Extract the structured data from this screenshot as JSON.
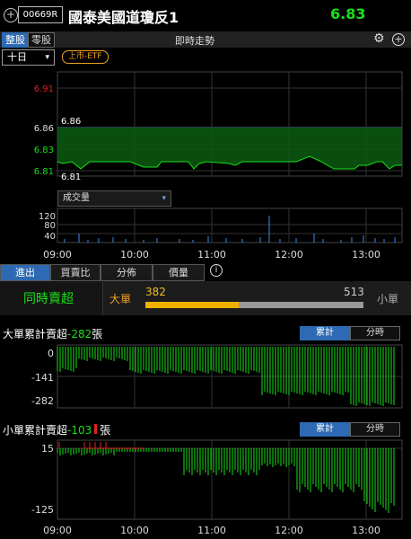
{
  "header": {
    "code": "00669R",
    "title": "國泰美國道瓊反1",
    "price": "6.83"
  },
  "toolbar": {
    "tab_odd": "整股",
    "tab_lot": "零股",
    "section_title": "即時走勢",
    "period": "十日",
    "badge": "上市-ETF"
  },
  "price_chart": {
    "y_labels": [
      "6.91",
      "6.86",
      "6.83",
      "6.81"
    ],
    "hi_label": "6.86",
    "lo_label": "6.81",
    "volume_select": "成交量",
    "vol_labels": [
      "120",
      "80",
      "40"
    ],
    "x_labels": [
      "09:00",
      "10:00",
      "11:00",
      "12:00",
      "13:00"
    ]
  },
  "tabs": [
    "進出",
    "買賣比",
    "分佈",
    "價量"
  ],
  "summary": {
    "simul": "同時賣超",
    "big": "大單",
    "small": "小單",
    "big_value": "382",
    "small_value": "513",
    "big_ratio": 0.427
  },
  "big_acc": {
    "label_prefix": "大單累計賣超",
    "value": "-282",
    "unit": "張",
    "btn_acc": "累計",
    "btn_time": "分時",
    "y_labels": [
      "0",
      "-141",
      "-282"
    ]
  },
  "small_acc": {
    "label_prefix": "小單累計賣超",
    "value": "-103",
    "unit": "張",
    "btn_acc": "累計",
    "btn_time": "分時",
    "y_labels": [
      "15",
      "-125"
    ],
    "x_labels": [
      "09:00",
      "10:00",
      "11:00",
      "12:00",
      "13:00"
    ]
  },
  "colors": {
    "up": "#e02020",
    "down": "#19e019",
    "accent": "#2d6ab3",
    "orange": "#f0a020"
  }
}
